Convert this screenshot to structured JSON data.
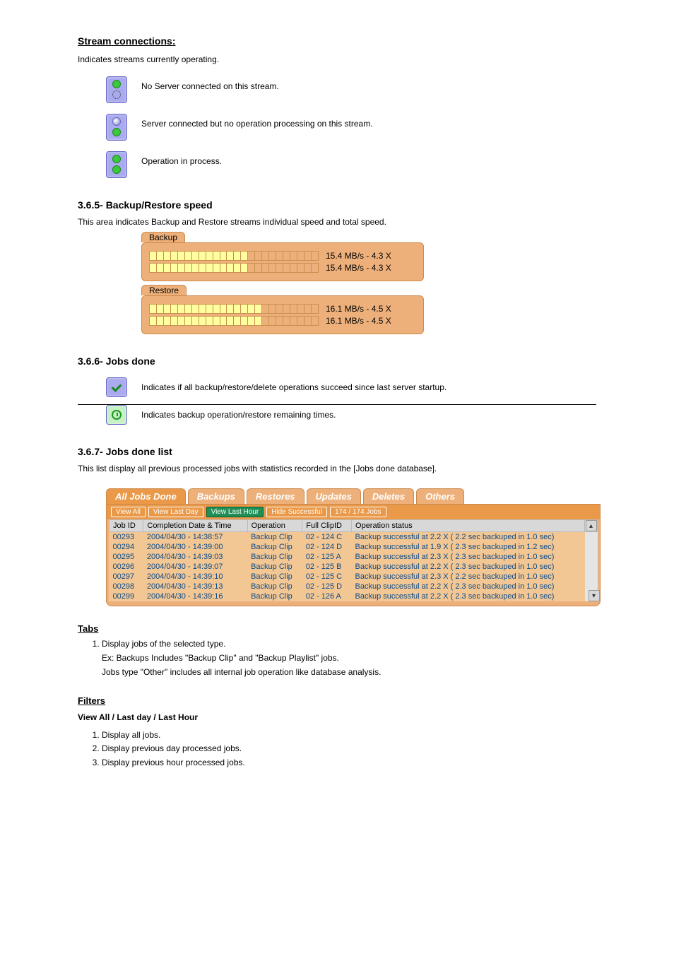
{
  "section1": {
    "title": "Stream connections:",
    "intro": "Indicates streams currently operating.",
    "states": [
      {
        "name": "disconnected",
        "text": "No Server connected on this stream."
      },
      {
        "name": "connected-nowork",
        "text": "Server connected but no operation processing on this stream."
      },
      {
        "name": "connected-working",
        "text": "Operation in process."
      }
    ]
  },
  "section2": {
    "heading": "3.6.5- Backup/Restore speed",
    "text": "This area indicates Backup and Restore streams individual speed and total speed.",
    "panels": [
      {
        "label": "Backup",
        "rows": [
          {
            "fill": 14,
            "total": 24,
            "text": "15.4 MB/s - 4.3 X"
          },
          {
            "fill": 14,
            "total": 24,
            "text": "15.4 MB/s - 4.3 X"
          }
        ]
      },
      {
        "label": "Restore",
        "rows": [
          {
            "fill": 16,
            "total": 24,
            "text": "16.1 MB/s - 4.5 X"
          },
          {
            "fill": 16,
            "total": 24,
            "text": "16.1 MB/s - 4.5 X"
          }
        ]
      }
    ]
  },
  "section3": {
    "heading": "3.6.6- Jobs done",
    "twoButtons": [
      {
        "name": "check",
        "text": "Indicates if all backup/restore/delete operations succeed since last server startup."
      },
      {
        "name": "clock",
        "text": "Indicates backup operation/restore remaining times."
      }
    ]
  },
  "section4": {
    "heading": "3.6.7- Jobs done list",
    "text": "This list display all previous processed jobs with statistics recorded in the [Jobs done database].",
    "tabs": [
      "All Jobs Done",
      "Backups",
      "Restores",
      "Updates",
      "Deletes",
      "Others"
    ],
    "filters": [
      "View All",
      "View Last Day",
      "View Last Hour",
      "Hide Successful",
      "174 / 174 Jobs"
    ],
    "active_filter_index": 2,
    "columns": [
      "Job ID",
      "Completion Date & Time",
      "Operation",
      "Full ClipID",
      "Operation status"
    ],
    "rows": [
      {
        "id": "00293",
        "dt": "2004/04/30 - 14:38:57",
        "op": "Backup Clip",
        "clip": "02 - 124 C",
        "status": "Backup successful at 2.2 X ( 2.2 sec backuped in 1.0 sec)"
      },
      {
        "id": "00294",
        "dt": "2004/04/30 - 14:39:00",
        "op": "Backup Clip",
        "clip": "02 - 124 D",
        "status": "Backup successful at 1.9 X ( 2.3 sec backuped in 1.2 sec)"
      },
      {
        "id": "00295",
        "dt": "2004/04/30 - 14:39:03",
        "op": "Backup Clip",
        "clip": "02 - 125 A",
        "status": "Backup successful at 2.3 X ( 2.3 sec backuped in 1.0 sec)"
      },
      {
        "id": "00296",
        "dt": "2004/04/30 - 14:39:07",
        "op": "Backup Clip",
        "clip": "02 - 125 B",
        "status": "Backup successful at 2.2 X ( 2.3 sec backuped in 1.0 sec)"
      },
      {
        "id": "00297",
        "dt": "2004/04/30 - 14:39:10",
        "op": "Backup Clip",
        "clip": "02 - 125 C",
        "status": "Backup successful at 2.3 X ( 2.2 sec backuped in 1.0 sec)"
      },
      {
        "id": "00298",
        "dt": "2004/04/30 - 14:39:13",
        "op": "Backup Clip",
        "clip": "02 - 125 D",
        "status": "Backup successful at 2.2 X ( 2.3 sec backuped in 1.0 sec)"
      },
      {
        "id": "00299",
        "dt": "2004/04/30 - 14:39:16",
        "op": "Backup Clip",
        "clip": "02 - 126 A",
        "status": "Backup successful at 2.2 X ( 2.3 sec backuped in 1.0 sec)"
      }
    ],
    "tabsExplain": [
      "Display jobs of the selected type.",
      "Ex: Backups Includes \"Backup Clip\" and \"Backup Playlist\" jobs.",
      "Jobs type \"Other\" includes all internal job operation like database analysis."
    ],
    "filtersHead": "View All / Last day / Last Hour",
    "filtersBullets": [
      "Display all jobs.",
      "Display previous day processed jobs.",
      "Display previous hour processed jobs."
    ]
  },
  "tabsLabel": "Tabs",
  "filtersLabel": "Filters"
}
